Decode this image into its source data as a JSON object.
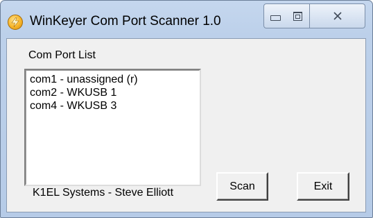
{
  "window": {
    "title": "WinKeyer Com Port Scanner 1.0",
    "icon": "winkeyer-app-icon",
    "controls": {
      "minimize": "minimize-icon",
      "maximize": "maximize-icon",
      "close": "close-icon"
    }
  },
  "com_port_list": {
    "label": "Com Port List",
    "items": [
      "com1 - unassigned (r)",
      "com2 - WKUSB 1",
      "com4 - WKUSB 3"
    ]
  },
  "footer": {
    "credit": "K1EL Systems - Steve Elliott"
  },
  "buttons": {
    "scan": "Scan",
    "exit": "Exit"
  },
  "colors": {
    "title_bar": "#bcd0ea",
    "client_bg": "#f0f0f0",
    "icon_accent": "#f7b52a"
  }
}
